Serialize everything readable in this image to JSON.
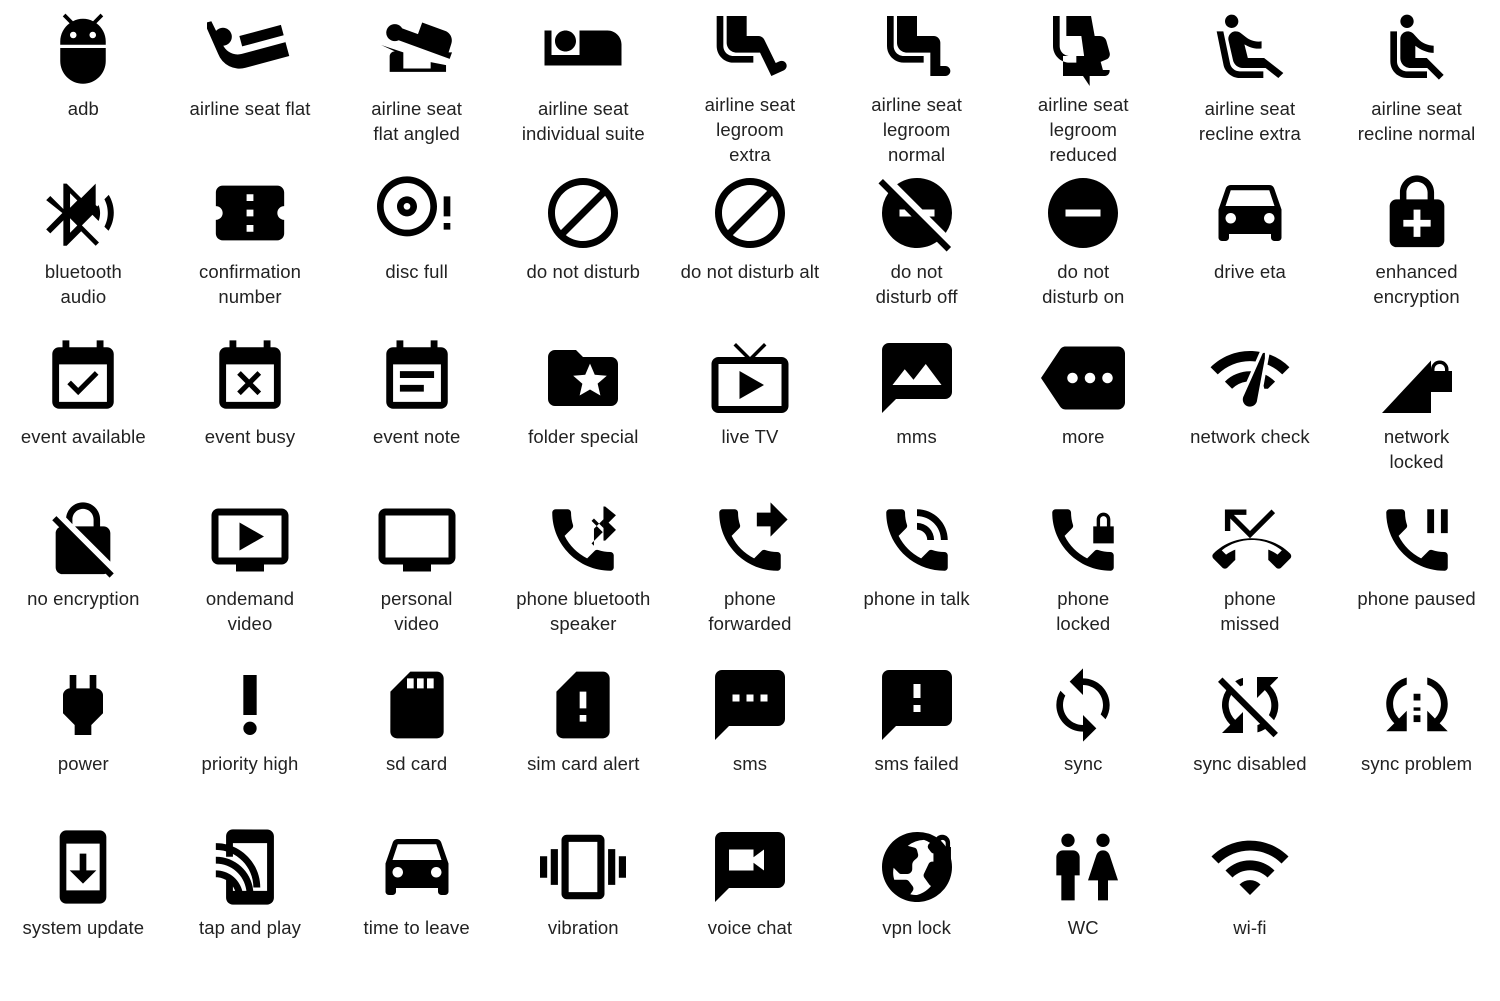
{
  "sheet": {
    "title": "Material notification icons sheet",
    "columns": 9,
    "rows": 6,
    "icon_color": "#000000",
    "label_color": "#222222",
    "background": "#ffffff"
  },
  "icons": [
    {
      "id": "adb",
      "label": "adb",
      "icon": "adb-icon"
    },
    {
      "id": "airline-seat-flat",
      "label": "airline seat flat",
      "icon": "airline-seat-flat-icon"
    },
    {
      "id": "airline-seat-flat-angled",
      "label": "airline seat\nflat angled",
      "icon": "airline-seat-flat-angled-icon"
    },
    {
      "id": "airline-seat-individual-suite",
      "label": "airline seat\nindividual suite",
      "icon": "airline-seat-individual-suite-icon"
    },
    {
      "id": "airline-seat-legroom-extra",
      "label": "airline seat\nlegroom\nextra",
      "icon": "airline-seat-legroom-extra-icon"
    },
    {
      "id": "airline-seat-legroom-normal",
      "label": "airline seat\nlegroom\nnormal",
      "icon": "airline-seat-legroom-normal-icon"
    },
    {
      "id": "airline-seat-legroom-reduced",
      "label": "airline seat\nlegroom\nreduced",
      "icon": "airline-seat-legroom-reduced-icon"
    },
    {
      "id": "airline-seat-recline-extra",
      "label": "airline seat\nrecline extra",
      "icon": "airline-seat-recline-extra-icon"
    },
    {
      "id": "airline-seat-recline-normal",
      "label": "airline seat\nrecline normal",
      "icon": "airline-seat-recline-normal-icon"
    },
    {
      "id": "bluetooth-audio",
      "label": "bluetooth\naudio",
      "icon": "bluetooth-audio-icon"
    },
    {
      "id": "confirmation-number",
      "label": "confirmation\nnumber",
      "icon": "confirmation-number-icon"
    },
    {
      "id": "disc-full",
      "label": "disc full",
      "icon": "disc-full-icon"
    },
    {
      "id": "do-not-disturb",
      "label": "do not disturb",
      "icon": "do-not-disturb-icon"
    },
    {
      "id": "do-not-disturb-alt",
      "label": "do not disturb alt",
      "icon": "do-not-disturb-alt-icon"
    },
    {
      "id": "do-not-disturb-off",
      "label": "do not\ndisturb off",
      "icon": "do-not-disturb-off-icon"
    },
    {
      "id": "do-not-disturb-on",
      "label": "do not\ndisturb on",
      "icon": "do-not-disturb-on-icon"
    },
    {
      "id": "drive-eta",
      "label": "drive eta",
      "icon": "drive-eta-icon"
    },
    {
      "id": "enhanced-encryption",
      "label": "enhanced\nencryption",
      "icon": "enhanced-encryption-icon"
    },
    {
      "id": "event-available",
      "label": "event available",
      "icon": "event-available-icon"
    },
    {
      "id": "event-busy",
      "label": "event busy",
      "icon": "event-busy-icon"
    },
    {
      "id": "event-note",
      "label": "event note",
      "icon": "event-note-icon"
    },
    {
      "id": "folder-special",
      "label": "folder special",
      "icon": "folder-special-icon"
    },
    {
      "id": "live-tv",
      "label": "live TV",
      "icon": "live-tv-icon"
    },
    {
      "id": "mms",
      "label": "mms",
      "icon": "mms-icon"
    },
    {
      "id": "more",
      "label": "more",
      "icon": "more-icon"
    },
    {
      "id": "network-check",
      "label": "network check",
      "icon": "network-check-icon"
    },
    {
      "id": "network-locked",
      "label": "network\nlocked",
      "icon": "network-locked-icon"
    },
    {
      "id": "no-encryption",
      "label": "no encryption",
      "icon": "no-encryption-icon"
    },
    {
      "id": "ondemand-video",
      "label": "ondemand\nvideo",
      "icon": "ondemand-video-icon"
    },
    {
      "id": "personal-video",
      "label": "personal\nvideo",
      "icon": "personal-video-icon"
    },
    {
      "id": "phone-bluetooth-speaker",
      "label": "phone bluetooth\nspeaker",
      "icon": "phone-bluetooth-speaker-icon"
    },
    {
      "id": "phone-forwarded",
      "label": "phone\nforwarded",
      "icon": "phone-forwarded-icon"
    },
    {
      "id": "phone-in-talk",
      "label": "phone in talk",
      "icon": "phone-in-talk-icon"
    },
    {
      "id": "phone-locked",
      "label": "phone\nlocked",
      "icon": "phone-locked-icon"
    },
    {
      "id": "phone-missed",
      "label": "phone\nmissed",
      "icon": "phone-missed-icon"
    },
    {
      "id": "phone-paused",
      "label": "phone paused",
      "icon": "phone-paused-icon"
    },
    {
      "id": "power",
      "label": "power",
      "icon": "power-icon"
    },
    {
      "id": "priority-high",
      "label": "priority high",
      "icon": "priority-high-icon"
    },
    {
      "id": "sd-card",
      "label": "sd card",
      "icon": "sd-card-icon"
    },
    {
      "id": "sim-card-alert",
      "label": "sim card alert",
      "icon": "sim-card-alert-icon"
    },
    {
      "id": "sms",
      "label": "sms",
      "icon": "sms-icon"
    },
    {
      "id": "sms-failed",
      "label": "sms failed",
      "icon": "sms-failed-icon"
    },
    {
      "id": "sync",
      "label": "sync",
      "icon": "sync-icon"
    },
    {
      "id": "sync-disabled",
      "label": "sync disabled",
      "icon": "sync-disabled-icon"
    },
    {
      "id": "sync-problem",
      "label": "sync problem",
      "icon": "sync-problem-icon"
    },
    {
      "id": "system-update",
      "label": "system update",
      "icon": "system-update-icon"
    },
    {
      "id": "tap-and-play",
      "label": "tap and play",
      "icon": "tap-and-play-icon"
    },
    {
      "id": "time-to-leave",
      "label": "time to leave",
      "icon": "time-to-leave-icon"
    },
    {
      "id": "vibration",
      "label": "vibration",
      "icon": "vibration-icon"
    },
    {
      "id": "voice-chat",
      "label": "voice chat",
      "icon": "voice-chat-icon"
    },
    {
      "id": "vpn-lock",
      "label": "vpn lock",
      "icon": "vpn-lock-icon"
    },
    {
      "id": "wc",
      "label": "WC",
      "icon": "wc-icon"
    },
    {
      "id": "wi-fi",
      "label": "wi-fi",
      "icon": "wifi-icon"
    },
    {
      "id": "empty",
      "label": "",
      "icon": "none"
    }
  ]
}
